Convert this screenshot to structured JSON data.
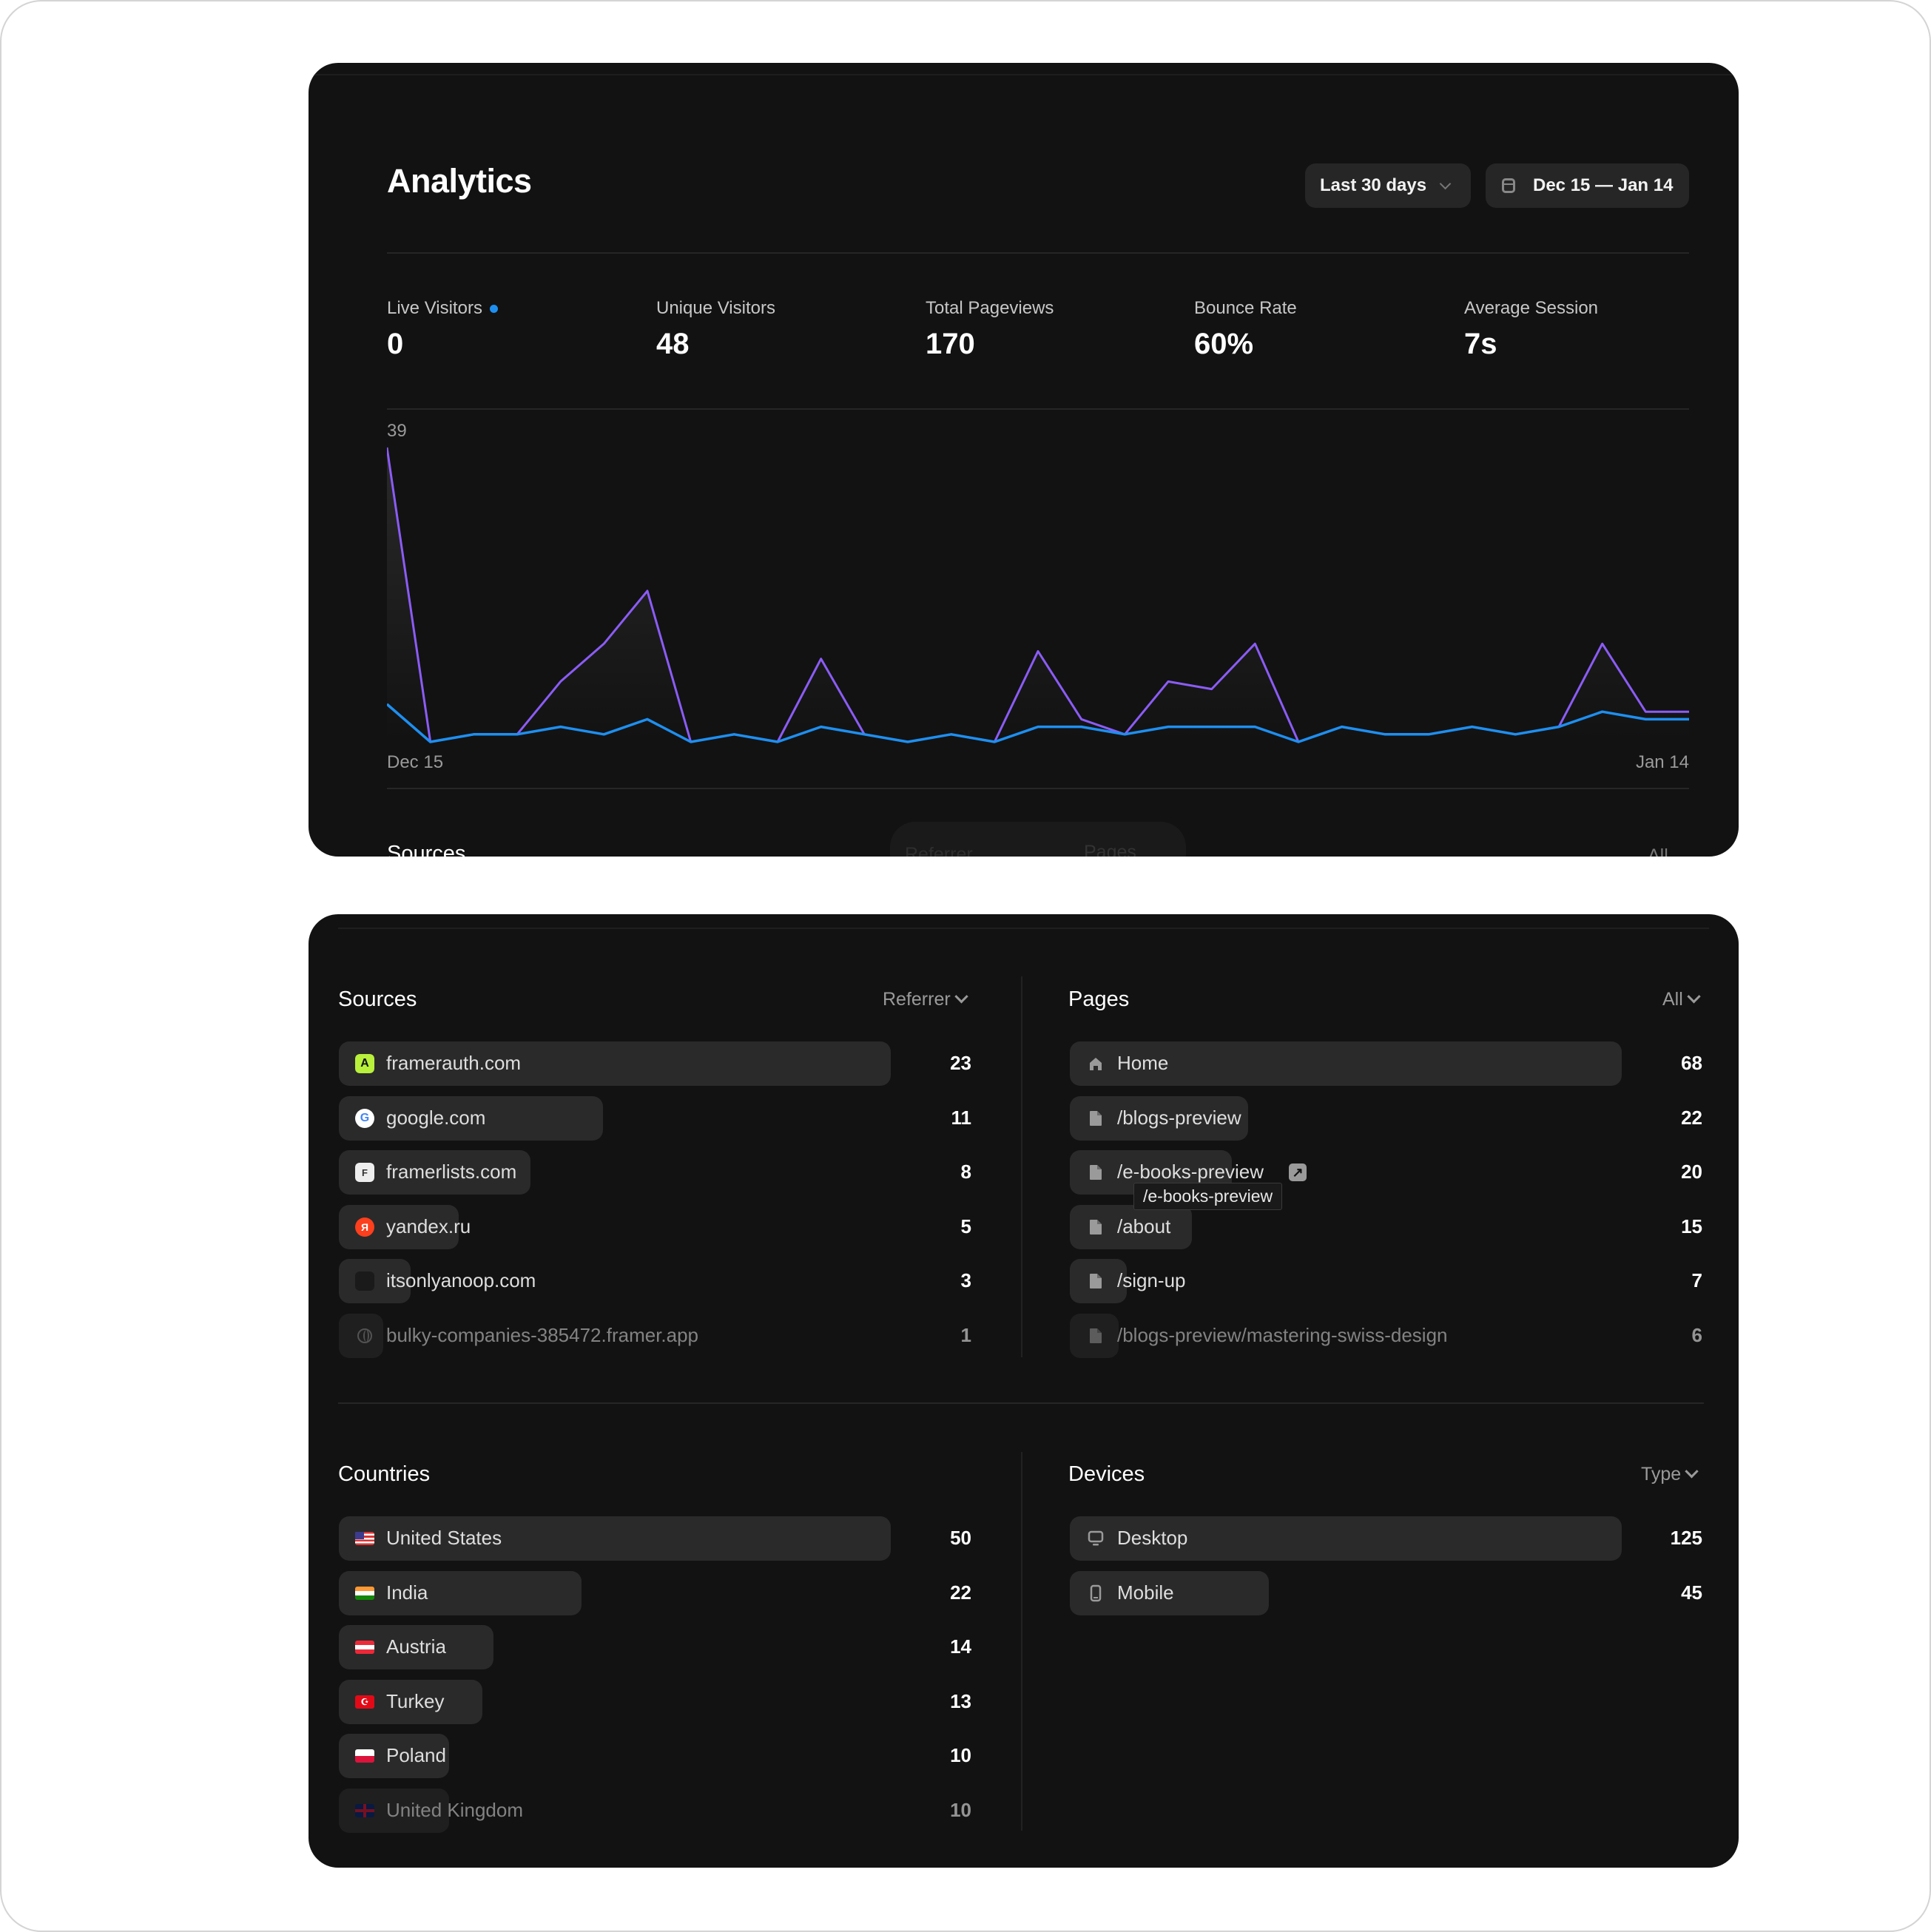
{
  "header": {
    "title": "Analytics",
    "range_select": {
      "label": "Last 30 days"
    },
    "date_range": {
      "label": "Dec 15 — Jan 14",
      "icon": "calendar-icon"
    }
  },
  "stats": [
    {
      "label": "Live Visitors",
      "value": "0",
      "live_indicator": true
    },
    {
      "label": "Unique Visitors",
      "value": "48"
    },
    {
      "label": "Total Pageviews",
      "value": "170"
    },
    {
      "label": "Bounce Rate",
      "value": "60%"
    },
    {
      "label": "Average Session",
      "value": "7s"
    }
  ],
  "colors": {
    "live_dot": "#1e8ff0",
    "pageviews_line": "#8b5cf6",
    "visitors_line": "#1e8ff0",
    "card_bg": "#121212",
    "bar_bg": "#2a2a2a"
  },
  "chart_data": {
    "type": "line",
    "title": "",
    "xlabel": "",
    "ylabel": "",
    "x_tick_labels": [
      "Dec 15",
      "Jan 14"
    ],
    "y_max_label": "39",
    "ylim": [
      0,
      39
    ],
    "x": [
      "Dec 15",
      "Dec 16",
      "Dec 17",
      "Dec 18",
      "Dec 19",
      "Dec 20",
      "Dec 21",
      "Dec 22",
      "Dec 23",
      "Dec 24",
      "Dec 25",
      "Dec 26",
      "Dec 27",
      "Dec 28",
      "Dec 29",
      "Dec 30",
      "Dec 31",
      "Jan 1",
      "Jan 2",
      "Jan 3",
      "Jan 4",
      "Jan 5",
      "Jan 6",
      "Jan 7",
      "Jan 8",
      "Jan 9",
      "Jan 10",
      "Jan 11",
      "Jan 12",
      "Jan 13",
      "Jan 14"
    ],
    "series": [
      {
        "name": "Pageviews",
        "color": "#8b5cf6",
        "values": [
          39,
          0,
          1,
          1,
          8,
          13,
          20,
          0,
          1,
          0,
          11,
          1,
          0,
          1,
          0,
          12,
          3,
          1,
          8,
          7,
          13,
          0,
          2,
          1,
          1,
          2,
          1,
          2,
          13,
          4,
          4
        ]
      },
      {
        "name": "Visitors",
        "color": "#1e8ff0",
        "values": [
          5,
          0,
          1,
          1,
          2,
          1,
          3,
          0,
          1,
          0,
          2,
          1,
          0,
          1,
          0,
          2,
          2,
          1,
          2,
          2,
          2,
          0,
          2,
          1,
          1,
          2,
          1,
          2,
          4,
          3,
          3
        ]
      }
    ],
    "grid": false,
    "legend": "none"
  },
  "peek": {
    "sources_title": "Sources",
    "referrer_label": "Referrer",
    "pages_label": "Pages",
    "all_label": "All"
  },
  "sources": {
    "title": "Sources",
    "filter": "Referrer",
    "max": 23,
    "items": [
      {
        "label": "framerauth.com",
        "value": 23,
        "icon": "framerauth-favicon"
      },
      {
        "label": "google.com",
        "value": 11,
        "icon": "google-favicon"
      },
      {
        "label": "framerlists.com",
        "value": 8,
        "icon": "framerlists-favicon"
      },
      {
        "label": "yandex.ru",
        "value": 5,
        "icon": "yandex-favicon"
      },
      {
        "label": "itsonlyanoop.com",
        "value": 3,
        "icon": "itsonlyanoop-favicon"
      },
      {
        "label": "bulky-companies-385472.framer.app",
        "value": 1,
        "icon": "globe-icon"
      }
    ]
  },
  "pages": {
    "title": "Pages",
    "filter": "All",
    "max": 68,
    "items": [
      {
        "label": "Home",
        "value": 68,
        "icon": "home-icon"
      },
      {
        "label": "/blogs-preview",
        "value": 22,
        "icon": "file-icon"
      },
      {
        "label": "/e-books-preview",
        "value": 20,
        "icon": "file-icon",
        "hovered": true,
        "tooltip": "/e-books-preview"
      },
      {
        "label": "/about",
        "value": 15,
        "icon": "file-icon"
      },
      {
        "label": "/sign-up",
        "value": 7,
        "icon": "file-icon"
      },
      {
        "label": "/blogs-preview/mastering-swiss-design",
        "value": 6,
        "icon": "file-icon"
      }
    ]
  },
  "countries": {
    "title": "Countries",
    "max": 50,
    "items": [
      {
        "label": "United States",
        "value": 50,
        "icon": "us-flag-icon"
      },
      {
        "label": "India",
        "value": 22,
        "icon": "india-flag-icon"
      },
      {
        "label": "Austria",
        "value": 14,
        "icon": "austria-flag-icon"
      },
      {
        "label": "Turkey",
        "value": 13,
        "icon": "turkey-flag-icon"
      },
      {
        "label": "Poland",
        "value": 10,
        "icon": "poland-flag-icon"
      },
      {
        "label": "United Kingdom",
        "value": 10,
        "icon": "uk-flag-icon"
      }
    ]
  },
  "devices": {
    "title": "Devices",
    "filter": "Type",
    "max": 125,
    "items": [
      {
        "label": "Desktop",
        "value": 125,
        "icon": "desktop-icon"
      },
      {
        "label": "Mobile",
        "value": 45,
        "icon": "mobile-icon"
      }
    ]
  }
}
